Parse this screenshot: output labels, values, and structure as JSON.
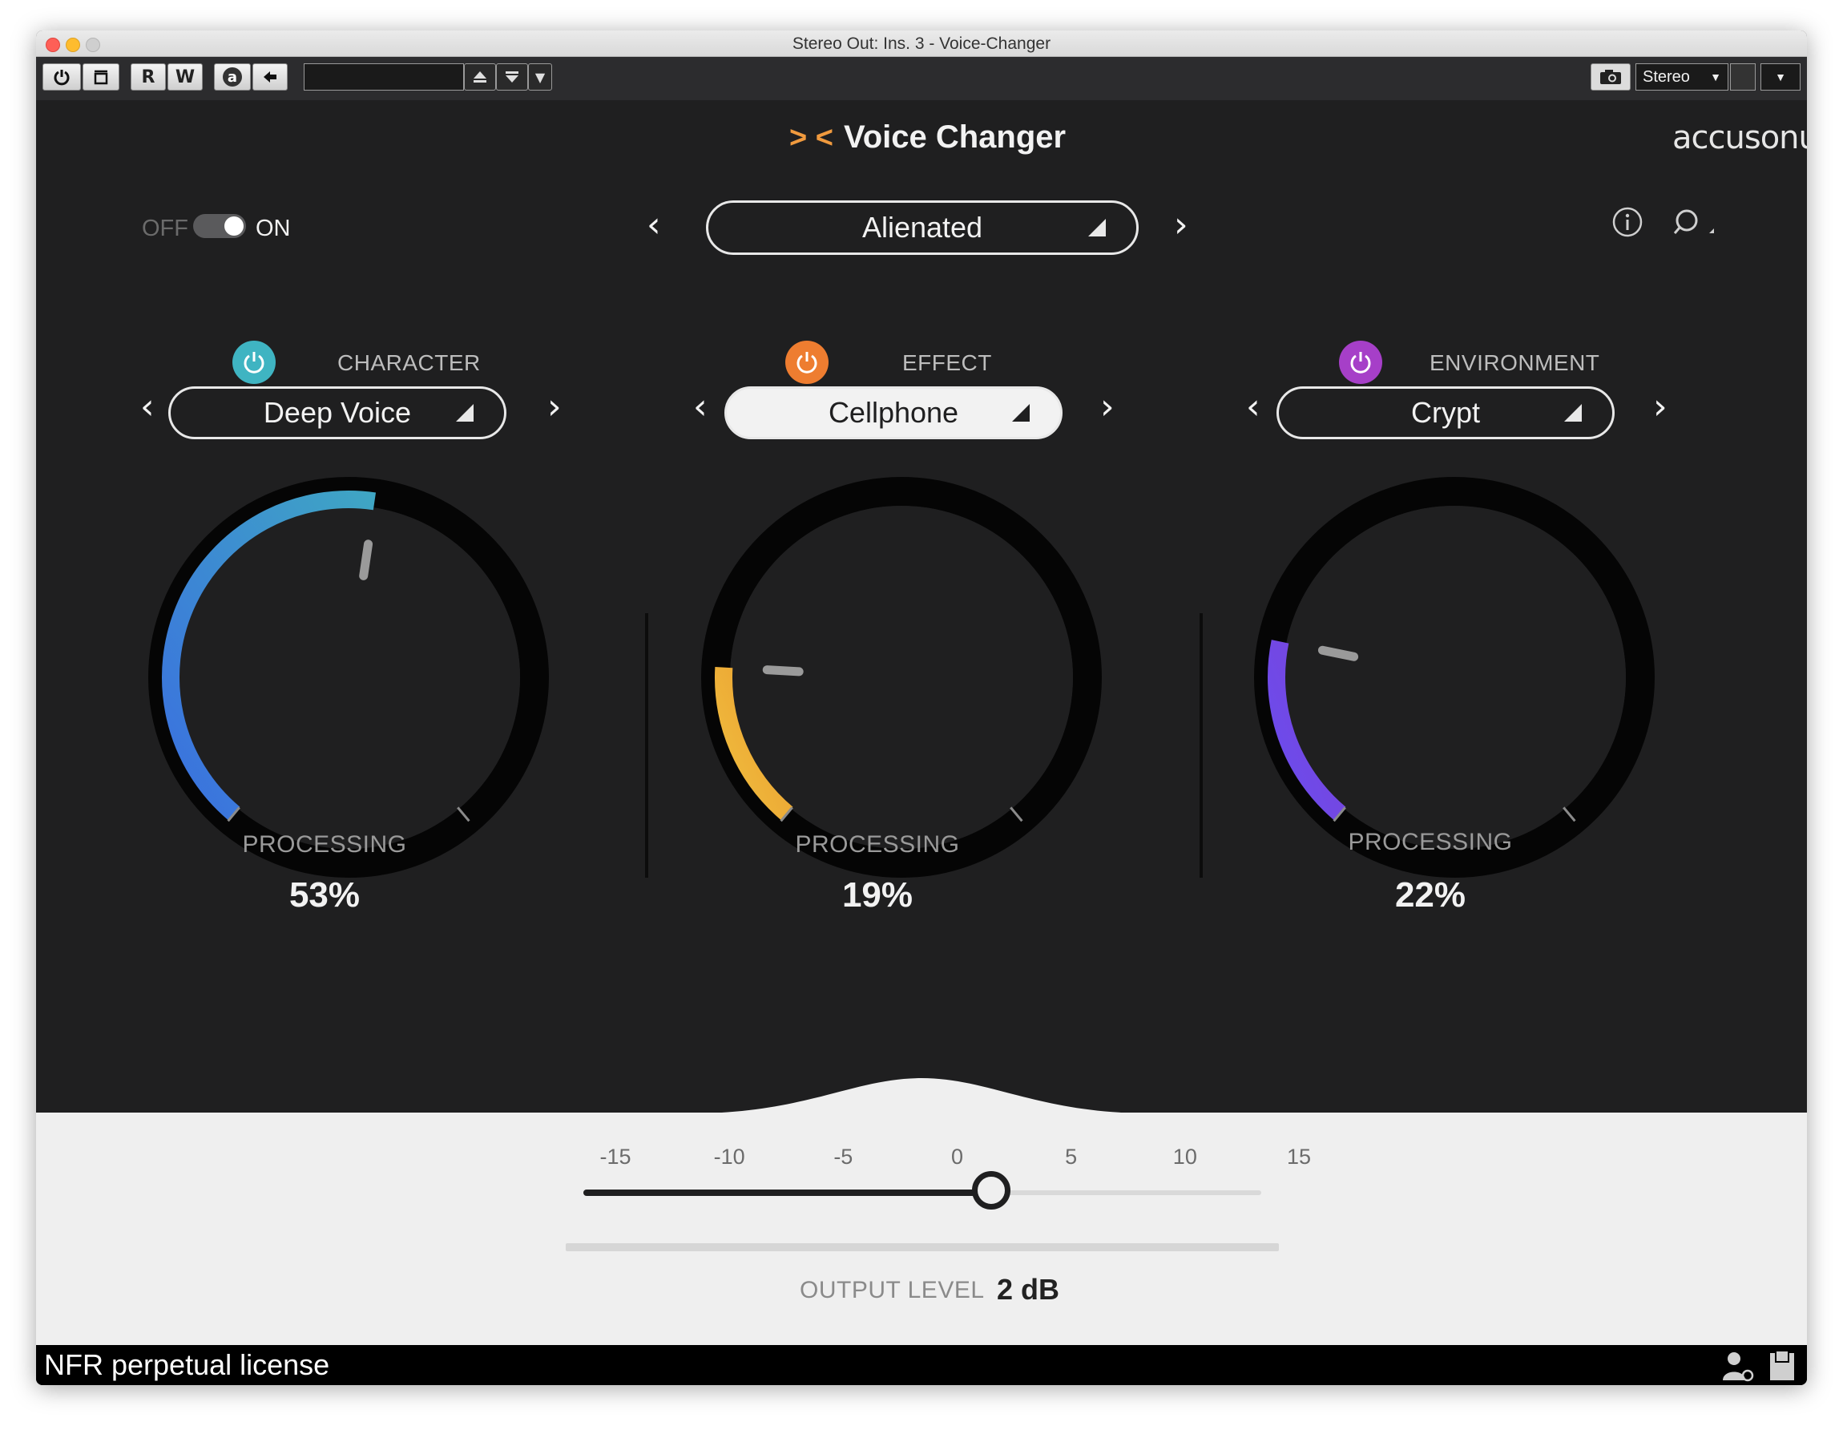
{
  "window": {
    "title": "Stereo Out: Ins. 3 - Voice-Changer"
  },
  "toolbar": {
    "read_label": "R",
    "write_label": "W",
    "auto_label": "a",
    "output_select": "Stereo"
  },
  "header": {
    "logo_glyph": "> <",
    "plugin_name": "Voice Changer",
    "brand": "accusonus"
  },
  "power_toggle": {
    "off_label": "OFF",
    "on_label": "ON",
    "state": "on"
  },
  "preset": {
    "name": "Alienated"
  },
  "sections": [
    {
      "id": "character",
      "label": "CHARACTER",
      "preset": "Deep Voice",
      "processing_label": "PROCESSING",
      "processing_value": "53%",
      "percent": 53,
      "color_start": "#3a6fe0",
      "color_end": "#3fa6c4",
      "power_color": "#3fb4c2",
      "preset_filled": false
    },
    {
      "id": "effect",
      "label": "EFFECT",
      "preset": "Cellphone",
      "processing_label": "PROCESSING",
      "processing_value": "19%",
      "percent": 19,
      "color_start": "#f0bf3f",
      "color_end": "#ea9b2f",
      "power_color": "#ee7d30",
      "preset_filled": true
    },
    {
      "id": "environment",
      "label": "ENVIRONMENT",
      "preset": "Crypt",
      "processing_label": "PROCESSING",
      "processing_value": "22%",
      "percent": 22,
      "color_start": "#6a4cf0",
      "color_end": "#7b44d6",
      "power_color": "#a63fc8",
      "preset_filled": false
    }
  ],
  "output": {
    "ticks": [
      "-15",
      "-10",
      "-5",
      "0",
      "5",
      "10",
      "15"
    ],
    "label": "OUTPUT LEVEL",
    "value_text": "2 dB",
    "value_db": 2,
    "min_db": -15,
    "max_db": 15
  },
  "status": {
    "license": "NFR perpetual license"
  },
  "colors": {
    "panel_bg": "#1f1f20",
    "footer_bg": "#efefef",
    "accent_orange": "#f09a3e"
  }
}
